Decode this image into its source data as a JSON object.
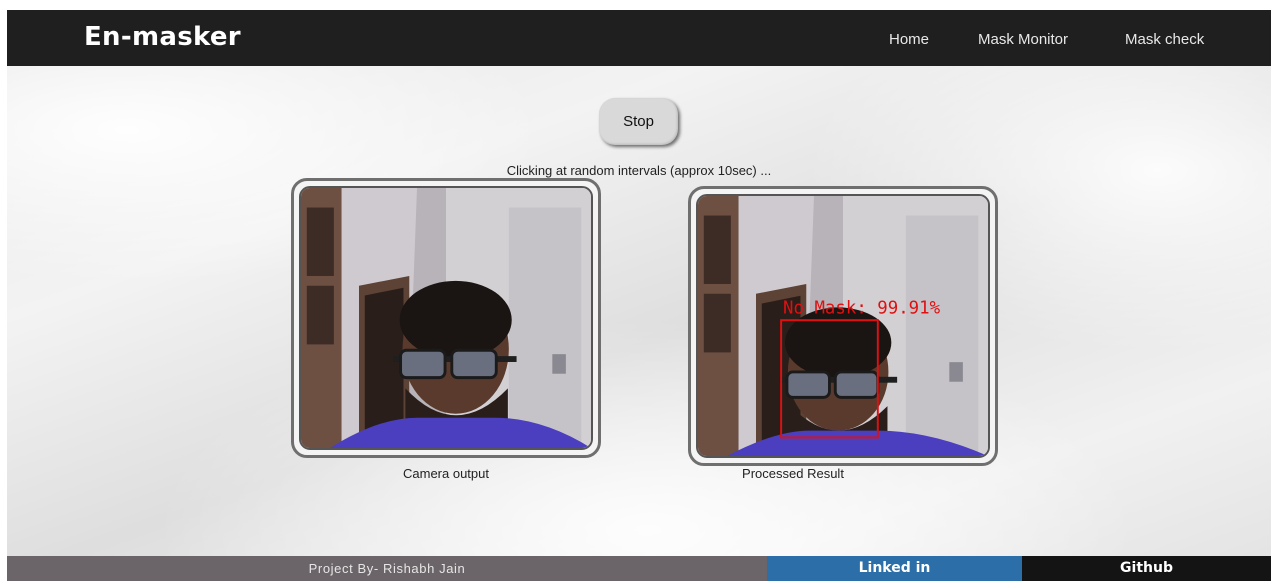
{
  "navbar": {
    "brand": "En-masker",
    "links": [
      "Home",
      "Mask Monitor",
      "Mask check"
    ]
  },
  "controls": {
    "stop_label": "Stop",
    "status_text": "Clicking at random intervals (approx 10sec) ..."
  },
  "panels": {
    "camera": {
      "caption": "Camera output"
    },
    "processed": {
      "caption": "Processed Result",
      "detection_label": "No Mask: 99.91%",
      "detection_color": "#e01010"
    }
  },
  "footer": {
    "credit": "Project By- Rishabh Jain",
    "linkedin": "Linked in",
    "github": "Github"
  },
  "colors": {
    "navbar_bg": "#1f1f1f",
    "footer_credit_bg": "#6b6468",
    "linkedin_bg": "#2c6ea7",
    "github_bg": "#141414"
  }
}
